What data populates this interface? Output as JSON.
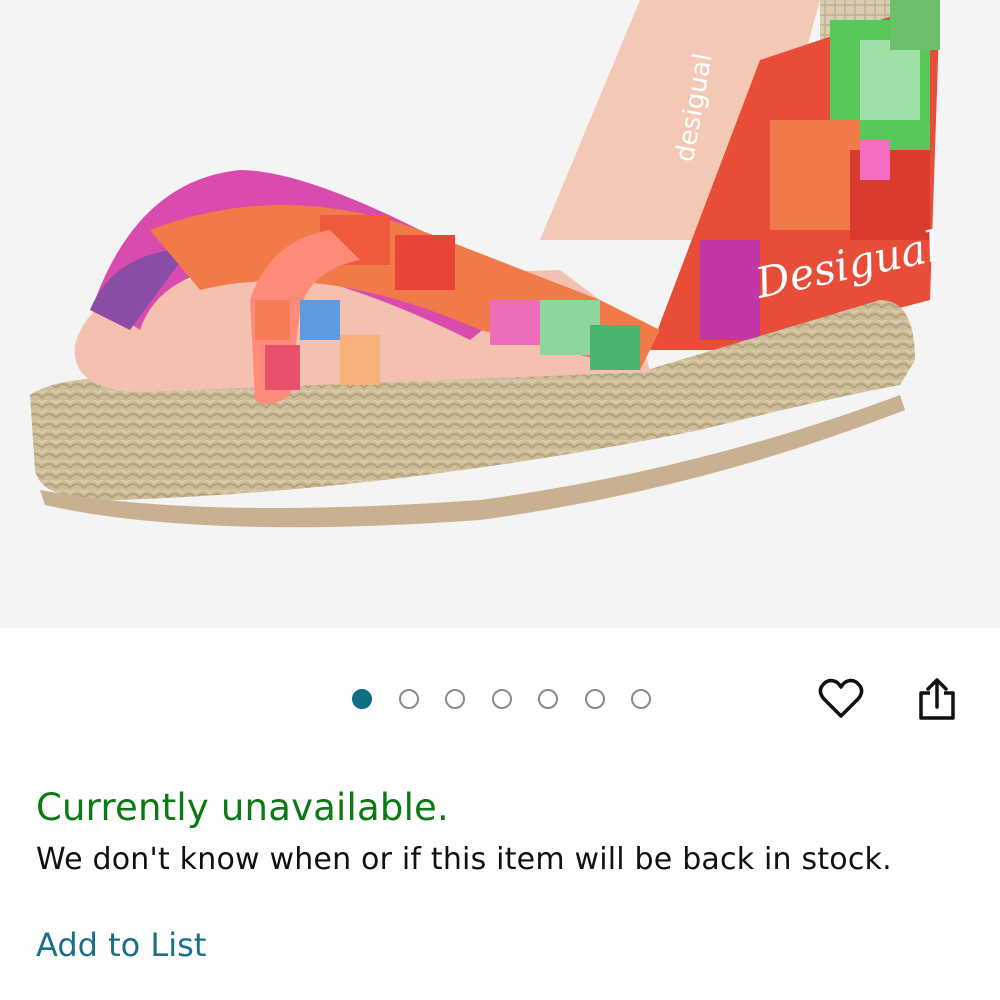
{
  "product_image": {
    "brand_print": "Desigual",
    "insole_print": "desigual"
  },
  "carousel": {
    "total": 7,
    "active_index": 0
  },
  "actions": {
    "wishlist_icon": "heart-icon",
    "share_icon": "share-icon"
  },
  "availability": {
    "status": "Currently unavailable.",
    "message": "We don't know when or if this item will be back in stock."
  },
  "add_to_list": "Add to List",
  "colors": {
    "available_green": "#0a7a12",
    "link_teal": "#1b6f88",
    "dot_active": "#0f6e84"
  }
}
